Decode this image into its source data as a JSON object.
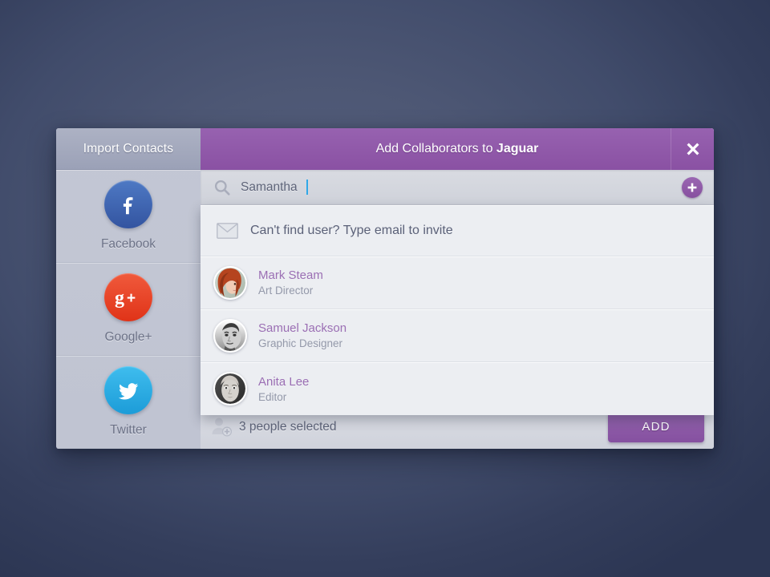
{
  "sidebar": {
    "header_title": "Import Contacts",
    "items": [
      {
        "label": "Facebook",
        "icon": "facebook-icon",
        "color": "#3b5ea8"
      },
      {
        "label": "Google+",
        "icon": "googleplus-icon",
        "color": "#e8442c"
      },
      {
        "label": "Twitter",
        "icon": "twitter-icon",
        "color": "#29ace3"
      }
    ]
  },
  "dialog": {
    "title_prefix": "Add Collaborators to ",
    "title_project": "Jaguar",
    "close_icon": "close-icon",
    "accent_color": "#8d55a6"
  },
  "search": {
    "icon": "search-icon",
    "value": "Samantha",
    "placeholder": "Search people",
    "add_icon": "plus-icon"
  },
  "results": {
    "invite": {
      "icon": "envelope-icon",
      "text": "Can't find user? Type email to invite"
    },
    "people": [
      {
        "name": "Mark Steam",
        "role": "Art Director",
        "avatar": "avatar-red-haired-woman"
      },
      {
        "name": "Samuel Jackson",
        "role": "Graphic Designer",
        "avatar": "avatar-man-grayscale"
      },
      {
        "name": "Anita Lee",
        "role": "Editor",
        "avatar": "avatar-woman-grayscale"
      }
    ]
  },
  "footer": {
    "icon": "person-add-icon",
    "status": "3 people selected",
    "add_label": "ADD"
  }
}
